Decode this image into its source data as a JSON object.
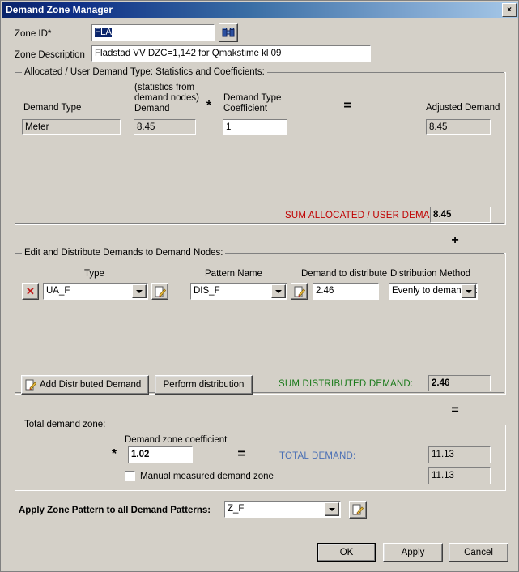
{
  "window": {
    "title": "Demand Zone Manager",
    "close_icon": "close-icon",
    "close_label": "×"
  },
  "header": {
    "zone_id_label": "Zone ID*",
    "zone_id_value": "FLA",
    "find_icon": "binoculars-icon",
    "zone_description_label": "Zone Description",
    "zone_description_value": "Fladstad VV DZC=1,142 for Qmakstime kl 09"
  },
  "allocated": {
    "group_title": "Allocated / User Demand Type: Statistics and Coefficients:",
    "headers": {
      "demand_type": "Demand Type",
      "statistics_note_line1": "(statistics from",
      "statistics_note_line2": "demand  nodes)",
      "statistics_note_line3": "Demand",
      "coefficient_line1": "Demand  Type",
      "coefficient_line2": "Coefficient",
      "adjusted_demand": "Adjusted Demand"
    },
    "operators": {
      "multiply": "*",
      "equals": "="
    },
    "row": {
      "demand_type": "Meter",
      "demand": "8.45",
      "coefficient": "1",
      "adjusted_demand": "8.45"
    },
    "sum_label": "SUM ALLOCATED / USER DEMAND:",
    "sum_value": "8.45",
    "sum_color": "#c00000"
  },
  "operators": {
    "plus": "+",
    "equals": "="
  },
  "distribute": {
    "group_title": "Edit and Distribute Demands to Demand Nodes:",
    "headers": {
      "type": "Type",
      "pattern_name": "Pattern Name",
      "demand_to_distribute": "Demand to distribute",
      "distribution_method": "Distribution Method"
    },
    "row": {
      "delete_icon": "red-x-icon",
      "type_value": "UA_F",
      "type_edit_icon": "pencil-edit-icon",
      "pattern_value": "DIS_F",
      "pattern_edit_icon": "pencil-edit-icon",
      "demand_value": "2.46",
      "method_value": "Evenly to demand no"
    },
    "add_button_label": "Add Distributed Demand",
    "add_button_icon": "pencil-edit-icon",
    "perform_button_label": "Perform distribution",
    "sum_label": "SUM DISTRIBUTED DEMAND:",
    "sum_value": "2.46",
    "sum_color": "#1a7a1a"
  },
  "total": {
    "group_title": "Total demand zone:",
    "coefficient_label": "Demand zone coefficient",
    "multiply": "*",
    "coefficient_value": "1.02",
    "equals": "=",
    "total_label": "TOTAL DEMAND:",
    "total_color": "#4a6fb5",
    "total_value": "11.13",
    "manual_checkbox_label": "Manual measured demand zone",
    "manual_checked": false,
    "manual_value": "11.13"
  },
  "apply_pattern": {
    "label": "Apply Zone Pattern to all Demand Patterns:",
    "value": "Z_F",
    "edit_icon": "pencil-edit-icon"
  },
  "footer": {
    "ok_label": "OK",
    "apply_label": "Apply",
    "cancel_label": "Cancel"
  }
}
